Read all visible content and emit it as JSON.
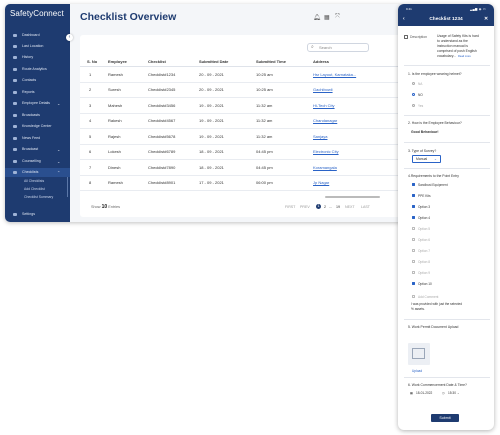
{
  "app": {
    "logo": "SafetyConnect"
  },
  "sidebar": {
    "items": [
      {
        "label": "Dashboard",
        "icon": "dashboard-icon"
      },
      {
        "label": "Last Location",
        "icon": "location-pin-icon"
      },
      {
        "label": "History",
        "icon": "history-icon"
      },
      {
        "label": "Route Analytics",
        "icon": "route-icon"
      },
      {
        "label": "Contacts",
        "icon": "contacts-icon"
      },
      {
        "label": "Reports",
        "icon": "reports-icon"
      },
      {
        "label": "Employee Details",
        "icon": "employee-icon",
        "chevron": "⌄"
      },
      {
        "label": "Broadcasts",
        "icon": "broadcast-icon"
      },
      {
        "label": "Knowledge Center",
        "icon": "book-icon"
      },
      {
        "label": "News Feed",
        "icon": "news-icon"
      },
      {
        "label": "Broadcast",
        "icon": "megaphone-icon",
        "chevron": "⌄"
      },
      {
        "label": "Counselling",
        "icon": "chat-icon",
        "chevron": "⌄"
      },
      {
        "label": "Checklists",
        "icon": "checklist-icon",
        "chevron": "⌃"
      }
    ],
    "sub_items": [
      "All Checklists",
      "Add Checklist",
      "Checklist Summary"
    ],
    "settings": "Settings"
  },
  "main": {
    "title": "Checklist Overview",
    "icons": [
      "bell-icon",
      "calendar-icon",
      "expand-icon"
    ],
    "search_placeholder": "Search",
    "columns": [
      "S. No",
      "Employee",
      "Checklist",
      "Submitted Date",
      "Submitted Time",
      "Address"
    ],
    "rows": [
      [
        "1",
        "Ramesh",
        "Checklist#1234",
        "20 - 09 - 2021",
        "10:25 am",
        "Hsr Layout, Karnataka..."
      ],
      [
        "2",
        "Suresh",
        "Checklist#2345",
        "20 - 09 - 2021",
        "10:25 am",
        "Gachibowli"
      ],
      [
        "3",
        "Mahesh",
        "Checklist#3456",
        "19 - 09 - 2021",
        "11:32 am",
        "Hi-Tech City"
      ],
      [
        "4",
        "Rakesh",
        "Checklist#4567",
        "19 - 09 - 2021",
        "11:32 am",
        "Chandanagar"
      ],
      [
        "5",
        "Rajesh",
        "Checklist#5678",
        "19 - 09 - 2021",
        "11:32 am",
        "Sanjaya"
      ],
      [
        "6",
        "Lokesh",
        "Checklist#6789",
        "18 - 09 - 2021",
        "04:45 pm",
        "Electronic City"
      ],
      [
        "7",
        "Dinesh",
        "Checklist#7890",
        "18 - 09 - 2021",
        "04:45 pm",
        "Koramangala"
      ],
      [
        "8",
        "Ramesh",
        "Checklist#8901",
        "17 - 09 - 2021",
        "06:00 pm",
        "Jp Nagar"
      ]
    ],
    "show_label": "Show",
    "show_value": "10",
    "entries_label": "Entries",
    "pager": {
      "first": "FIRST",
      "prev": "PREV",
      "current": "1",
      "p2": "2",
      "dots": "...",
      "last_num": "19",
      "next": "NEXT",
      "last": "LAST"
    }
  },
  "phone": {
    "time": "9:41",
    "signal": "▂▄▆ ◉ ▭",
    "title": "Checklist 1234",
    "desc_label": "Description",
    "desc_text": [
      "Usage of Safety Kits is hard",
      "to understand as the",
      "instruction manual is",
      "comprised of posh English",
      "vocabulary..."
    ],
    "read_more": "Read more",
    "q1": "1. Is the employee wearing helmet?",
    "q1_opts": [
      "NA",
      "NO",
      "Yes"
    ],
    "q2": "2. How is the Employee Behaviour?",
    "q2_answer": "Good Behaviour!",
    "q3": "3. Type of Survey?",
    "q3_value": "Manual",
    "q4": "4.Requirements to the Point Entry",
    "q4_opts": [
      {
        "label": "Sandbust Equipment",
        "on": true
      },
      {
        "label": "PPE Kits",
        "on": true
      },
      {
        "label": "Option 3",
        "on": true
      },
      {
        "label": "Option 4",
        "on": true
      },
      {
        "label": "Option 5",
        "on": false
      },
      {
        "label": "Option 6",
        "on": false
      },
      {
        "label": "Option 7",
        "on": false
      },
      {
        "label": "Option 8",
        "on": false
      },
      {
        "label": "Option 9",
        "on": false
      },
      {
        "label": "Option 10",
        "on": true
      }
    ],
    "q4_other_label": "Add Comment",
    "q4_comment": [
      "I was provided with just the selected",
      "% assets."
    ],
    "q5": "5. Work Permit Document Upload",
    "upload_label": "Upload",
    "q6": "6. Work Commencement Date & Time?",
    "q6_date": "18-01-2022",
    "q6_time": "15:30",
    "submit": "Submit"
  }
}
